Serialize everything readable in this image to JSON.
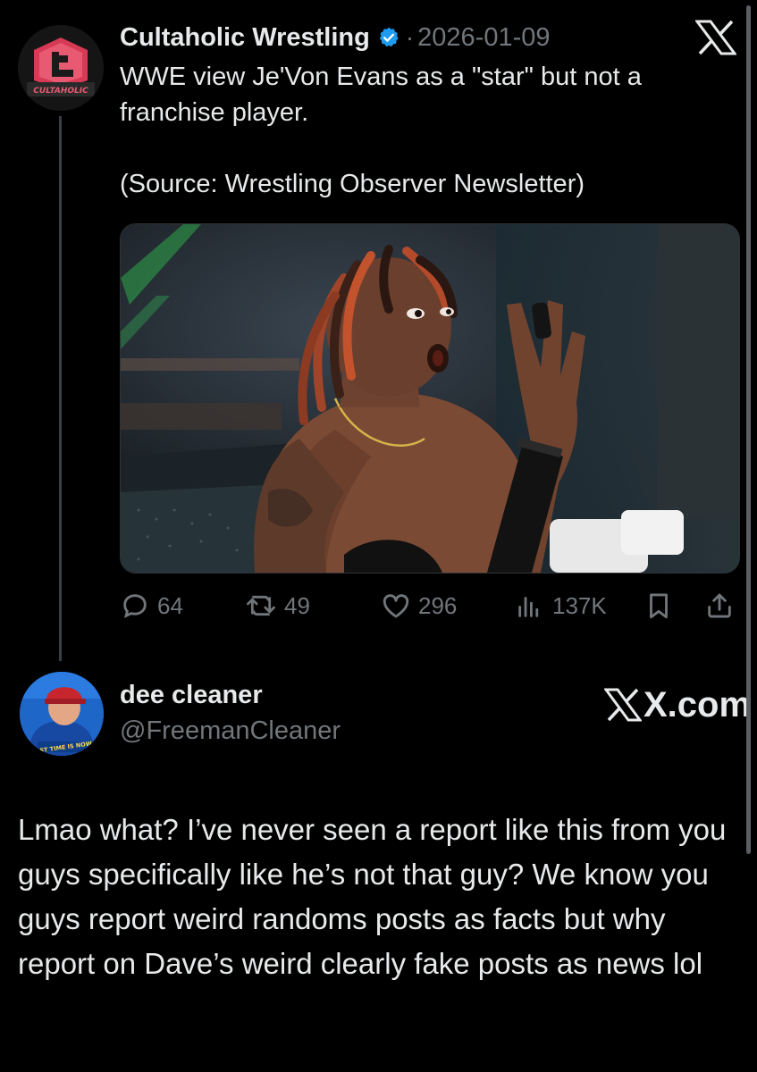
{
  "post": {
    "avatar_text": "CULTAHOLIC",
    "author": "Cultaholic Wrestling",
    "separator": "·",
    "date": "2026-01-09",
    "text_line1": "WWE view Je'Von Evans as a \"star\" but not a franchise player.",
    "text_line2": "(Source: Wrestling Observer Newsletter)",
    "icons": {
      "verified": "verified-badge-icon",
      "platform": "x-logo-icon"
    },
    "actions": {
      "replies": "64",
      "reposts": "49",
      "likes": "296",
      "views": "137K"
    }
  },
  "reply": {
    "name": "dee cleaner",
    "handle": "@FreemanCleaner",
    "avatar_caption": "LAST TIME IS NOW",
    "watermark": "X.com",
    "text": "Lmao what? I’ve never seen a report like this from you guys specifically like he’s not that guy? We know you guys report weird randoms posts as facts but why report on Dave’s weird clearly fake posts as news lol"
  },
  "colors": {
    "background": "#000000",
    "text_primary": "#e7e9ea",
    "text_secondary": "#71767b",
    "verified": "#1d9bf0",
    "thread_line": "#3a3f44"
  }
}
